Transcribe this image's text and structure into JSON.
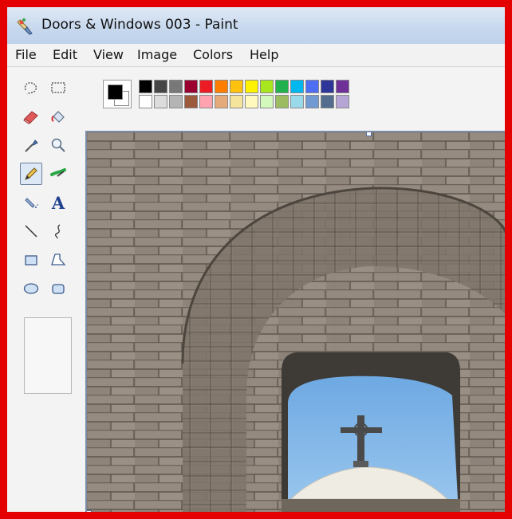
{
  "window": {
    "title": "Doors & Windows 003 - Paint"
  },
  "menu": {
    "items": [
      "File",
      "Edit",
      "View",
      "Image",
      "Colors",
      "Help"
    ]
  },
  "toolbox": {
    "tools": [
      {
        "name": "free-form-select",
        "icon": "lasso-select-icon"
      },
      {
        "name": "select",
        "icon": "rect-select-icon"
      },
      {
        "name": "eraser",
        "icon": "eraser-icon"
      },
      {
        "name": "fill",
        "icon": "paint-bucket-icon"
      },
      {
        "name": "pick-color",
        "icon": "eyedropper-icon"
      },
      {
        "name": "magnifier",
        "icon": "magnifier-icon"
      },
      {
        "name": "pencil",
        "icon": "pencil-icon",
        "selected": true
      },
      {
        "name": "brush",
        "icon": "brush-icon"
      },
      {
        "name": "airbrush",
        "icon": "airbrush-icon"
      },
      {
        "name": "text",
        "icon": "text-icon",
        "label": "A"
      },
      {
        "name": "line",
        "icon": "line-icon"
      },
      {
        "name": "curve",
        "icon": "curve-icon"
      },
      {
        "name": "rectangle",
        "icon": "rectangle-icon"
      },
      {
        "name": "polygon",
        "icon": "polygon-icon"
      },
      {
        "name": "ellipse",
        "icon": "ellipse-icon"
      },
      {
        "name": "rounded-rectangle",
        "icon": "rounded-rect-icon"
      }
    ]
  },
  "palette": {
    "foreground": "#000000",
    "background": "#ffffff",
    "row1": [
      "#000000",
      "#464646",
      "#787878",
      "#990030",
      "#ed1c24",
      "#ff7e00",
      "#ffc20e",
      "#fff200",
      "#a8e61d",
      "#22b14c",
      "#00b7ef",
      "#4d6df3",
      "#2f3699",
      "#6f3198"
    ],
    "row2": [
      "#ffffff",
      "#dcdcdc",
      "#b4b4b4",
      "#9c5a3c",
      "#ffa3b1",
      "#e5aa7a",
      "#f5e49c",
      "#fff9bd",
      "#d3f9bc",
      "#9dbb61",
      "#99d9ea",
      "#709ad1",
      "#546d8e",
      "#b5a5d5"
    ]
  },
  "canvas": {
    "image_description_colors": {
      "wall": "#8a8076",
      "sky": "#7fb6e8",
      "dome": "#efece4",
      "cross": "#4a4a4a"
    }
  },
  "frame": {
    "border_color": "#e50000"
  }
}
